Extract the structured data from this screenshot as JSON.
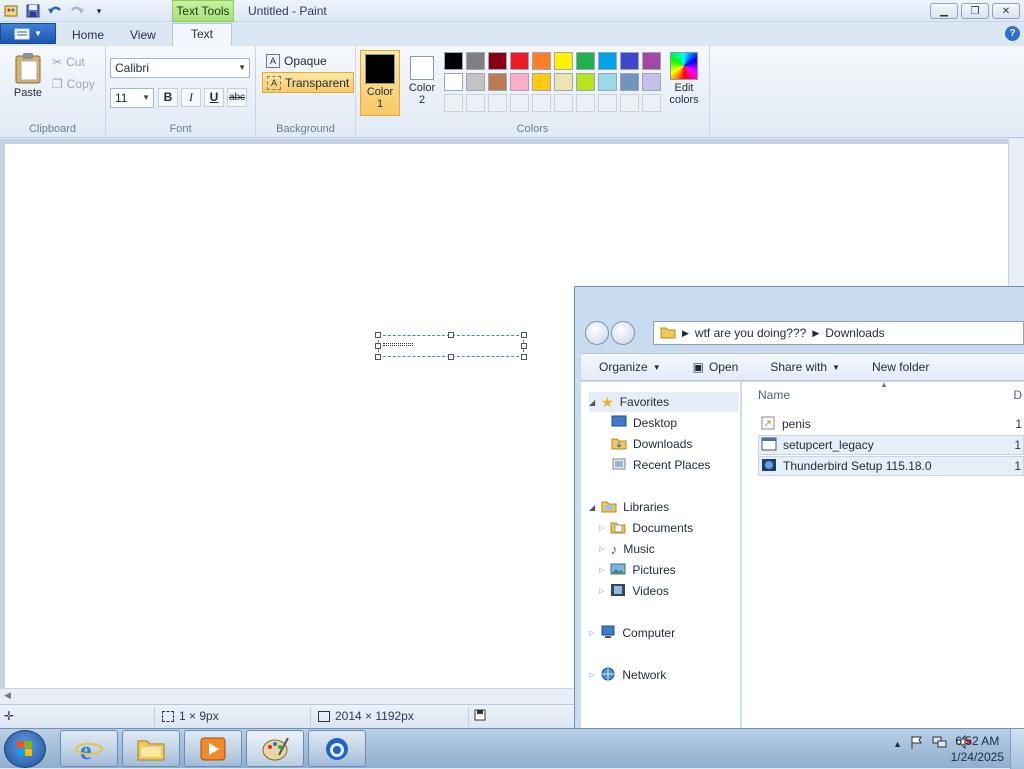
{
  "paint": {
    "title": "Untitled - Paint",
    "context_tab": "Text Tools",
    "tabs": [
      "Home",
      "View",
      "Text"
    ],
    "active_tab": "Text",
    "clipboard": {
      "paste": "Paste",
      "cut": "Cut",
      "copy": "Copy",
      "label": "Clipboard"
    },
    "font": {
      "family": "Calibri",
      "size": "11",
      "bold": "B",
      "italic": "I",
      "underline": "U",
      "strike": "abc",
      "label": "Font"
    },
    "background": {
      "opaque": "Opaque",
      "transparent": "Transparent",
      "label": "Background",
      "selected": "Transparent"
    },
    "colors": {
      "color1_label": "Color\n1",
      "color1_l1": "Color",
      "color1_l2": "1",
      "color2_l1": "Color",
      "color2_l2": "2",
      "color1": "#000000",
      "color2": "#ffffff",
      "edit_l1": "Edit",
      "edit_l2": "colors",
      "label": "Colors",
      "row1": [
        "#000000",
        "#7f7f7f",
        "#880015",
        "#ed1c24",
        "#ff7f27",
        "#fff200",
        "#22b14c",
        "#00a2e8",
        "#3f48cc",
        "#a349a4"
      ],
      "row2": [
        "#ffffff",
        "#c3c3c3",
        "#b97a57",
        "#ffaec9",
        "#ffc90e",
        "#efe4b0",
        "#b5e61d",
        "#99d9ea",
        "#7092be",
        "#c8bfe7"
      ]
    },
    "status": {
      "selection": "1 × 9px",
      "size": "2014 × 1192px"
    }
  },
  "explorer": {
    "breadcrumb": [
      "wtf are you doing???",
      "Downloads"
    ],
    "commands": [
      "Organize",
      "Open",
      "Share with",
      "New folder"
    ],
    "nav": {
      "favorites": "Favorites",
      "fav_items": [
        "Desktop",
        "Downloads",
        "Recent Places"
      ],
      "libraries": "Libraries",
      "lib_items": [
        "Documents",
        "Music",
        "Pictures",
        "Videos"
      ],
      "computer": "Computer",
      "network": "Network"
    },
    "column": "Name",
    "files": [
      {
        "name": "penis",
        "count": "1"
      },
      {
        "name": "setupcert_legacy",
        "count": "1"
      },
      {
        "name": "Thunderbird Setup 115.18.0",
        "count": "1"
      }
    ],
    "col2_initial": "D"
  },
  "taskbar": {
    "time": "6:52 AM",
    "date": "1/24/2025"
  }
}
